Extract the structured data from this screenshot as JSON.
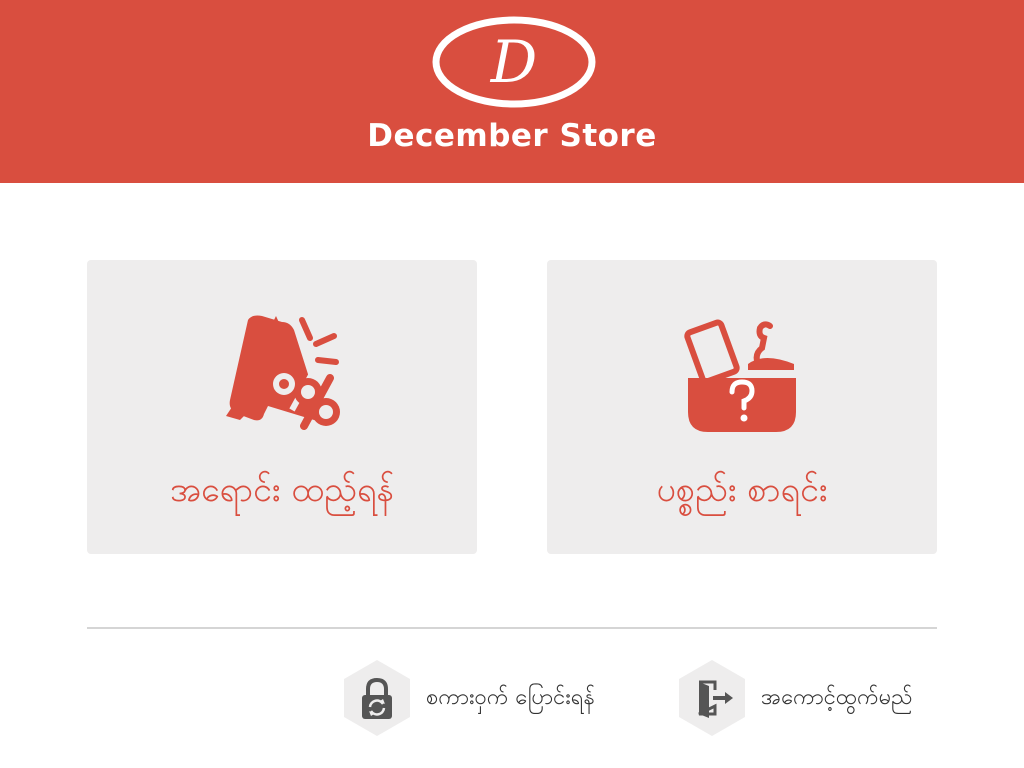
{
  "brand": {
    "logo_letter": "D",
    "store_name": "December Store",
    "accent_color": "#d94e3f"
  },
  "cards": [
    {
      "label": "အရောင်း ထည့်ရန်",
      "icon": "megaphone-percent-icon"
    },
    {
      "label": "ပစ္စည်း စာရင်း",
      "icon": "shopping-basket-question-icon"
    }
  ],
  "actions": {
    "change_password": {
      "label": "စကားဝှက် ပြောင်းရန်",
      "icon": "lock-refresh-icon"
    },
    "logout": {
      "label": "အကောင့်ထွက်မည်",
      "icon": "logout-door-icon"
    }
  }
}
